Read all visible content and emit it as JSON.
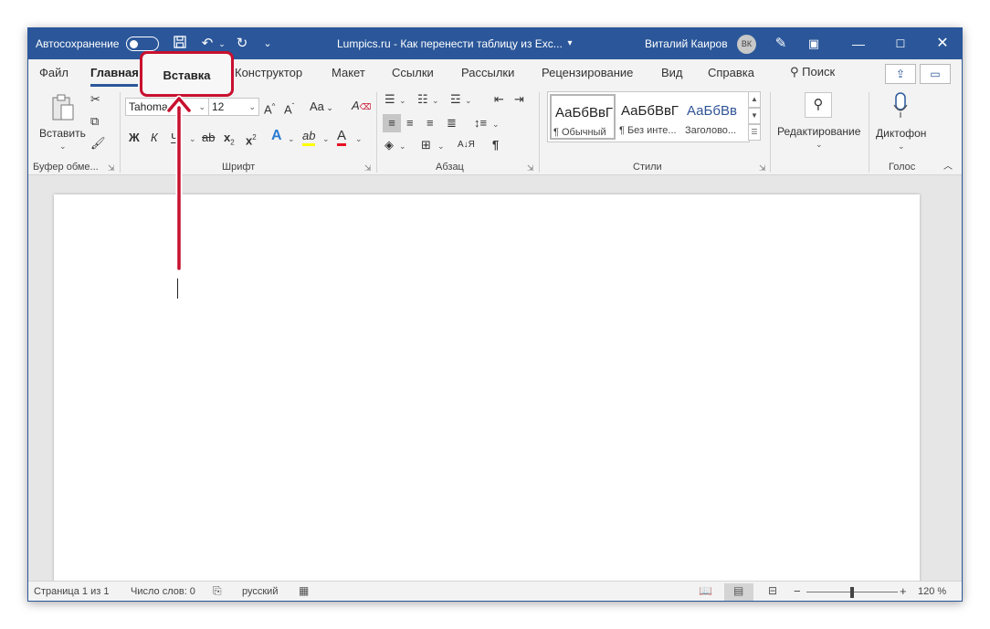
{
  "titlebar": {
    "autosave_label": "Автосохранение",
    "document_title": "Lumpics.ru - Как перенести таблицу из Exc...",
    "user_name": "Виталий Каиров",
    "user_initials": "ВК"
  },
  "tabs": {
    "file": "Файл",
    "home": "Главная",
    "insert": "Вставка",
    "design": "Конструктор",
    "layout": "Макет",
    "references": "Ссылки",
    "mailings": "Рассылки",
    "review": "Рецензирование",
    "view": "Вид",
    "help": "Справка",
    "search": "Поиск"
  },
  "ribbon": {
    "clipboard": {
      "paste_label": "Вставить",
      "group_label": "Буфер обме..."
    },
    "font": {
      "font_name": "Tahoma",
      "font_size": "12",
      "change_case": "Aa",
      "bold": "Ж",
      "italic": "К",
      "underline": "Ч",
      "strike": "ab",
      "subscript": "x",
      "subscript_index": "2",
      "superscript": "x",
      "superscript_index": "2",
      "text_effects": "A",
      "highlight": "ab",
      "font_color": "A",
      "group_label": "Шрифт"
    },
    "paragraph": {
      "sort": "А↓Я",
      "pilcrow": "¶",
      "group_label": "Абзац"
    },
    "styles": {
      "items": [
        {
          "sample": "АаБбВвГ",
          "name": "¶ Обычный"
        },
        {
          "sample": "АаБбВвГ",
          "name": "¶ Без инте..."
        },
        {
          "sample": "АаБбВв",
          "name": "Заголово..."
        }
      ],
      "group_label": "Стили"
    },
    "editing": {
      "label": "Редактирование"
    },
    "voice": {
      "dictate_label": "Диктофон",
      "group_label": "Голос"
    }
  },
  "statusbar": {
    "page": "Страница 1 из 1",
    "words": "Число слов: 0",
    "language": "русский",
    "zoom_minus": "−",
    "zoom_plus": "+",
    "zoom_percent": "120 %"
  },
  "colors": {
    "accent": "#2b579a",
    "callout": "#c8102e",
    "font_color_bar": "#e81123",
    "highlight_bar": "#ffff00"
  }
}
